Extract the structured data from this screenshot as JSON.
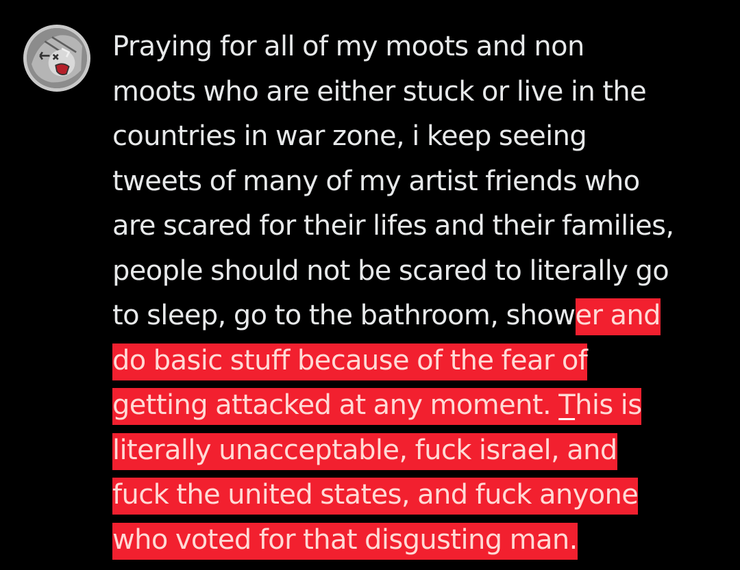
{
  "post": {
    "avatar_icon": "cartoon-face-avatar-icon",
    "highlight_color": "#f2202f",
    "text_color": "#e7e9ea",
    "lines": [
      {
        "plain": "Praying for all of my moots and non",
        "hl": ""
      },
      {
        "plain": "moots who are either stuck or live in the",
        "hl": ""
      },
      {
        "plain": "countries in war zone, i keep seeing",
        "hl": ""
      },
      {
        "plain": "tweets of many of my artist friends who",
        "hl": ""
      },
      {
        "plain": "are scared for their lifes and their families,",
        "hl": ""
      },
      {
        "plain": "people should not be scared to literally go",
        "hl": ""
      },
      {
        "plain": "to sleep, go to the bathroom, show",
        "hl": "er and"
      },
      {
        "plain": "",
        "hl": "do basic stuff because of the fear of"
      },
      {
        "plain": "",
        "hl": "getting attacked at any moment. ",
        "cursor_char": "T",
        "hl_after": "his is"
      },
      {
        "plain": "",
        "hl": "literally unacceptable, fuck israel, and"
      },
      {
        "plain": "",
        "hl": "fuck the united states, and fuck anyone"
      },
      {
        "plain": "",
        "hl": "who voted for that disgusting man."
      }
    ]
  }
}
